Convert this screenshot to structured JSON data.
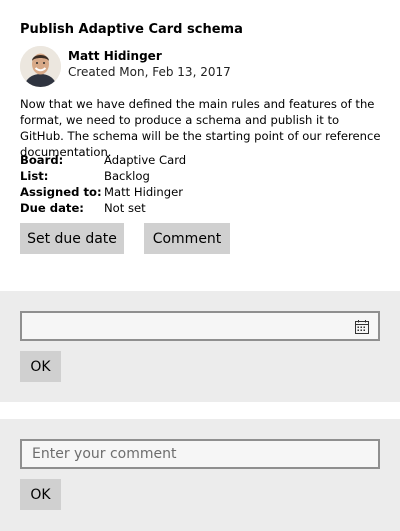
{
  "card": {
    "title": "Publish Adaptive Card schema",
    "author": {
      "name": "Matt Hidinger",
      "created": "Created Mon, Feb 13, 2017"
    },
    "description": "Now that we have defined the main rules and features of the format, we need to produce a schema and publish it to GitHub. The schema will be the starting point of our reference documentation.",
    "facts": [
      {
        "key": "Board:",
        "value": "Adaptive Card"
      },
      {
        "key": "List:",
        "value": "Backlog"
      },
      {
        "key": "Assigned to:",
        "value": "Matt Hidinger"
      },
      {
        "key": "Due date:",
        "value": "Not set"
      }
    ],
    "actions": {
      "set_due_date": "Set due date",
      "comment": "Comment"
    }
  },
  "due_date_panel": {
    "date_value": "",
    "ok_label": "OK"
  },
  "comment_panel": {
    "placeholder": "Enter your comment",
    "ok_label": "OK"
  }
}
